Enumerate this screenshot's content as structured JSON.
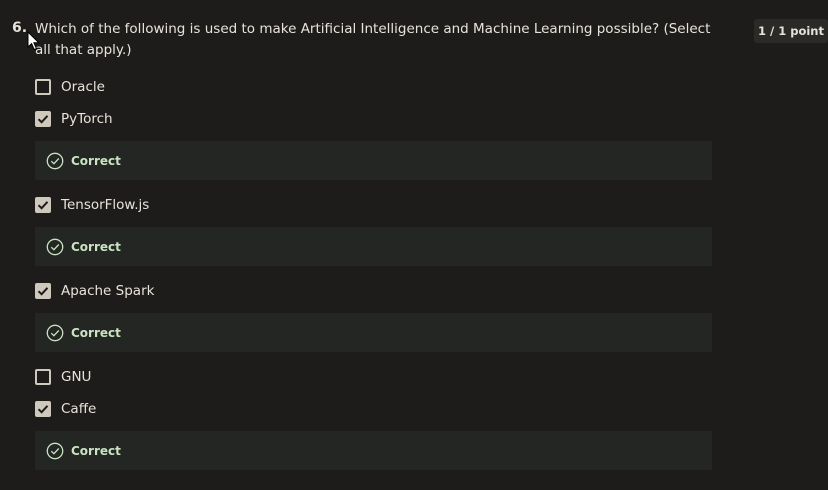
{
  "question": {
    "number": "6.",
    "text": "Which of the following is used to make Artificial Intelligence and Machine Learning possible? (Select all that apply.)",
    "score": "1 / 1 point"
  },
  "options": [
    {
      "label": "Oracle",
      "checked": false,
      "feedback": null
    },
    {
      "label": "PyTorch",
      "checked": true,
      "feedback": "Correct"
    },
    {
      "label": "TensorFlow.js",
      "checked": true,
      "feedback": "Correct"
    },
    {
      "label": "Apache Spark",
      "checked": true,
      "feedback": "Correct"
    },
    {
      "label": "GNU",
      "checked": false,
      "feedback": null
    },
    {
      "label": "Caffe",
      "checked": true,
      "feedback": "Correct"
    }
  ],
  "colors": {
    "background": "#1e1c1a",
    "feedback_background": "#232622",
    "feedback_text": "#c9e3c3",
    "checkbox": "#cfc8bc"
  },
  "icons": {
    "checkbox_checked": "check-icon",
    "feedback": "check-circle-icon",
    "cursor": "mouse-pointer-icon"
  }
}
